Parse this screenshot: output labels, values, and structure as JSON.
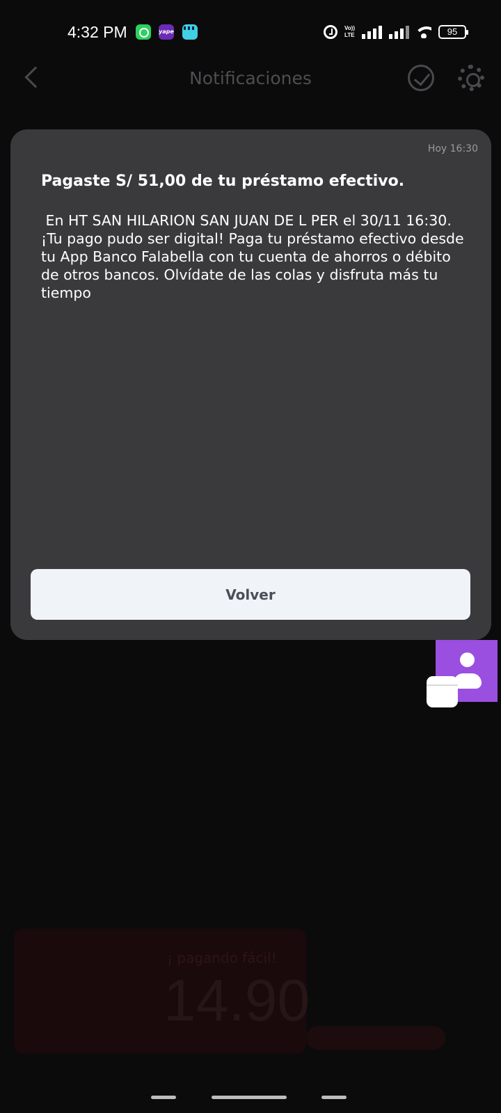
{
  "status_bar": {
    "time": "4:32 PM",
    "apps": [
      "whatsapp-icon",
      "yape-icon",
      "clapper-icon"
    ],
    "yape_text": "yape",
    "volte_top": "Vo))",
    "volte_bottom": "LTE",
    "battery": "95"
  },
  "header": {
    "title": "Notificaciones"
  },
  "notification": {
    "time": "Hoy 16:30",
    "title": "Pagaste S/ 51,00 de tu préstamo efectivo.",
    "body": " En HT SAN HILARION SAN JUAN DE L PER el 30/11 16:30. ¡Tu pago pudo ser digital! Paga tu préstamo efectivo desde tu App Banco Falabella con tu cuenta de ahorros o débito de otros bancos. Olvídate de las colas y disfruta más tu tiempo",
    "button": "Volver"
  },
  "background_promo": {
    "tag": "¡ pagando fácil!",
    "price": "14.90"
  },
  "colors": {
    "modal_bg": "#3a3a3c",
    "button_bg": "#f0f3f7",
    "contact_widget": "#9b4fe0"
  }
}
